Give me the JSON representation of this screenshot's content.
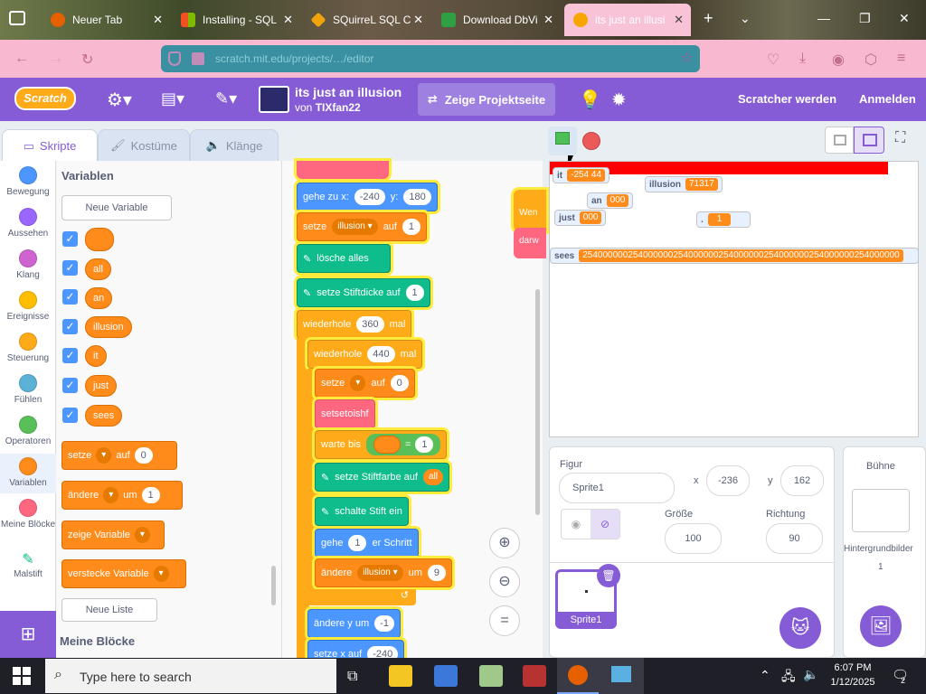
{
  "browser": {
    "tabs": [
      {
        "title": "Neuer Tab",
        "favicon_color": "#e66000"
      },
      {
        "title": "Installing - SQL",
        "favicon_color": "#f25022"
      },
      {
        "title": "SQuirreL SQL C",
        "favicon_color": "#f0a30a"
      },
      {
        "title": "Download DbVi",
        "favicon_color": "#2ea043"
      },
      {
        "title": "its just an illusi",
        "favicon_color": "#f7a600"
      }
    ],
    "url": "scratch.mit.edu/projects/…/editor"
  },
  "scratch": {
    "logo": "Scratch",
    "project_title": "its just an illusion",
    "author_prefix": "von",
    "author": "TIXfan22",
    "see_project_page": "Zeige Projektseite",
    "join": "Scratcher werden",
    "signin": "Anmelden",
    "accent": "#855cd6"
  },
  "editor_tabs": {
    "code": "Skripte",
    "costumes": "Kostüme",
    "sounds": "Klänge"
  },
  "categories": [
    {
      "label": "Bewegung",
      "color": "#4c97ff"
    },
    {
      "label": "Aussehen",
      "color": "#9966ff"
    },
    {
      "label": "Klang",
      "color": "#cf63cf"
    },
    {
      "label": "Ereignisse",
      "color": "#ffbf00"
    },
    {
      "label": "Steuerung",
      "color": "#ffab19"
    },
    {
      "label": "Fühlen",
      "color": "#5cb1d6"
    },
    {
      "label": "Operatoren",
      "color": "#59c059"
    },
    {
      "label": "Variablen",
      "color": "#ff8c1a"
    },
    {
      "label": "Meine Blöcke",
      "color": "#ff6680"
    },
    {
      "label": "Malstift",
      "color": "#0fbd8c"
    }
  ],
  "palette": {
    "title": "Variablen",
    "new_variable": "Neue Variable",
    "variables": [
      "",
      "all",
      "an",
      "illusion",
      "it",
      "just",
      "sees"
    ],
    "blocks": {
      "set": "setze",
      "set_to": "auf",
      "set_val": "0",
      "change": "ändere",
      "change_by": "um",
      "change_val": "1",
      "show": "zeige Variable",
      "hide": "verstecke Variable"
    },
    "new_list": "Neue Liste",
    "my_blocks_title": "Meine Blöcke"
  },
  "script": {
    "goto": "gehe zu x:",
    "goto_x": "-240",
    "goto_y_label": "y:",
    "goto_y": "180",
    "set": "setze",
    "set_var": "illusion",
    "set_to": "auf",
    "set_val": "1",
    "clear": "lösche alles",
    "pensize": "setze Stiftdicke auf",
    "pensize_val": "1",
    "repeat1": "wiederhole",
    "repeat1_val": "360",
    "repeat1_unit": "mal",
    "repeat2": "wiederhole",
    "repeat2_val": "440",
    "repeat2_unit": "mal",
    "set2": "setze",
    "set2_to": "auf",
    "set2_val": "0",
    "looks": "setsetoishf",
    "wait": "warte bis",
    "wait_eq": "=",
    "wait_val": "1",
    "pencolor": "setze Stiftfarbe auf",
    "pencolor_var": "all",
    "pendown": "schalte Stift ein",
    "move": "gehe",
    "move_val": "1",
    "move_unit": "er Schritt",
    "change": "ändere",
    "change_var": "illusion",
    "change_by": "um",
    "change_val": "9",
    "changey": "ändere y um",
    "changey_val": "-1",
    "setx": "setze x auf",
    "setx_val": "-240",
    "side1": "Wen",
    "side2": "darw"
  },
  "monitors": {
    "it": {
      "label": "it",
      "value": "-254 44"
    },
    "illusion": {
      "label": "illusion",
      "value": "71317"
    },
    "an": {
      "label": "an",
      "value": "000"
    },
    "just": {
      "label": "just",
      "value": "000"
    },
    "dot": {
      "label": ".",
      "value": "1"
    },
    "sees": {
      "label": "sees",
      "value": "254000000254000000254000000254000000254000000254000000254000000"
    }
  },
  "sprite": {
    "figure_label": "Figur",
    "name": "Sprite1",
    "x_label": "x",
    "x": "-236",
    "y_label": "y",
    "y": "162",
    "size_label": "Größe",
    "size": "100",
    "dir_label": "Richtung",
    "dir": "90",
    "thumb_label": "Sprite1"
  },
  "stage_panel": {
    "title": "Bühne",
    "backdrops_label": "Hintergrundbilder",
    "backdrops": "1"
  },
  "taskbar": {
    "search_placeholder": "Type here to search",
    "time": "6:07 PM",
    "date": "1/12/2025"
  }
}
